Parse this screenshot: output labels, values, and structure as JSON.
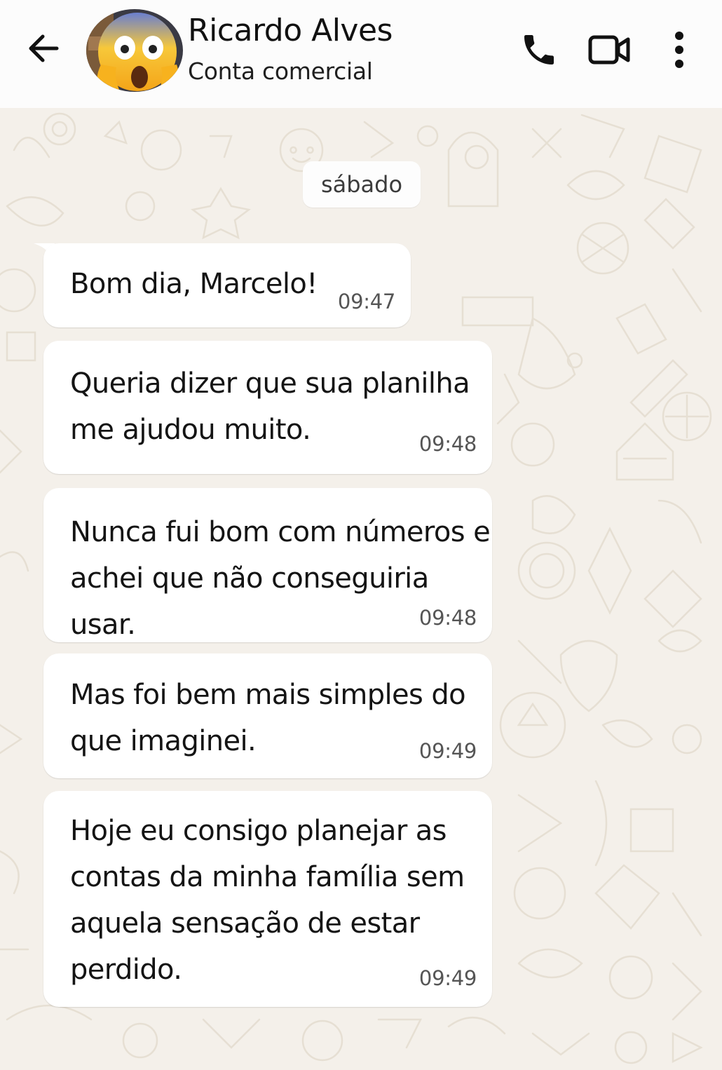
{
  "header": {
    "back_icon": "arrow-left-icon",
    "contact_name": "Ricardo Alves",
    "contact_subtitle": "Conta comercial",
    "avatar": "screaming-face-emoji",
    "actions": {
      "call_icon": "phone-icon",
      "video_icon": "video-camera-icon",
      "menu_icon": "three-dots-vertical-icon"
    }
  },
  "chat": {
    "date_divider": "sábado",
    "messages": [
      {
        "text": "Bom dia, Marcelo!",
        "time": "09:47",
        "direction": "incoming"
      },
      {
        "text": "Queria dizer que sua planilha\nme ajudou muito.",
        "time": "09:48",
        "direction": "incoming"
      },
      {
        "text": "Nunca fui bom com números e\nachei que não conseguiria usar.",
        "time": "09:48",
        "direction": "incoming"
      },
      {
        "text": "Mas foi bem mais simples do\nque imaginei.",
        "time": "09:49",
        "direction": "incoming"
      },
      {
        "text": "Hoje eu consigo planejar as\ncontas da minha família sem\naquela sensação de estar\nperdido.",
        "time": "09:49",
        "direction": "incoming"
      }
    ]
  },
  "colors": {
    "header_bg": "#fcfcfc",
    "chat_bg": "#f4f0ea",
    "bubble_bg": "#ffffff",
    "icon": "#111111"
  }
}
